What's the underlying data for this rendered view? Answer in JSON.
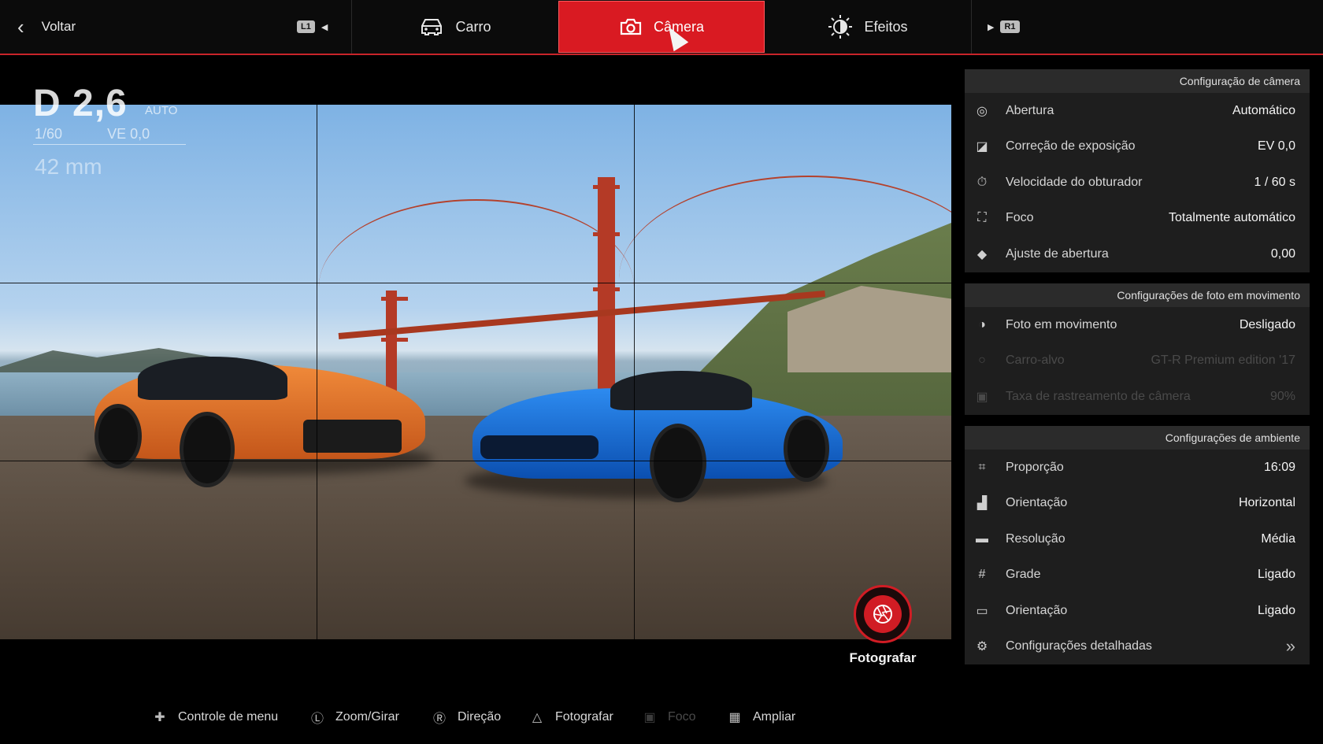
{
  "topbar": {
    "back_label": "Voltar",
    "l1_badge": "L1",
    "r1_badge": "R1",
    "tabs": [
      {
        "label": "Carro",
        "icon": "car-icon",
        "active": false
      },
      {
        "label": "Câmera",
        "icon": "camera-icon",
        "active": true
      },
      {
        "label": "Efeitos",
        "icon": "brightness-icon",
        "active": false
      }
    ],
    "accent_color": "#d91a22"
  },
  "viewfinder": {
    "mode": "D",
    "aperture": "2,6",
    "aperture_mode": "AUTO",
    "shutter": "1/60",
    "exposure": "VE 0,0",
    "focal_length": "42 mm"
  },
  "shutter_button": {
    "label": "Fotografar"
  },
  "camera_settings": {
    "header": "Configuração de câmera",
    "rows": [
      {
        "label": "Abertura",
        "value": "Automático",
        "icon": "aperture-icon",
        "disabled": false
      },
      {
        "label": "Correção de exposição",
        "value": "EV 0,0",
        "icon": "exposure-icon",
        "disabled": false
      },
      {
        "label": "Velocidade do obturador",
        "value": "1 / 60 s",
        "icon": "timer-icon",
        "disabled": false
      },
      {
        "label": "Foco",
        "value": "Totalmente automático",
        "icon": "focus-icon",
        "disabled": false
      },
      {
        "label": "Ajuste de abertura",
        "value": "0,00",
        "icon": "aperture-adjust-icon",
        "disabled": false
      }
    ]
  },
  "motion_settings": {
    "header": "Configurações de foto em movimento",
    "rows": [
      {
        "label": "Foto em movimento",
        "value": "Desligado",
        "icon": "toggle-icon",
        "disabled": false
      },
      {
        "label": "Carro-alvo",
        "value": "GT-R Premium edition '17",
        "icon": "target-icon",
        "disabled": true
      },
      {
        "label": "Taxa de rastreamento de câmera",
        "value": "90%",
        "icon": "tracking-icon",
        "disabled": true
      }
    ]
  },
  "environment_settings": {
    "header": "Configurações de ambiente",
    "rows": [
      {
        "label": "Proporção",
        "value": "16:09",
        "icon": "crop-icon",
        "disabled": false
      },
      {
        "label": "Orientação",
        "value": "Horizontal",
        "icon": "orientation-icon",
        "disabled": false
      },
      {
        "label": "Resolução",
        "value": "Média",
        "icon": "resolution-icon",
        "disabled": false
      },
      {
        "label": "Grade",
        "value": "Ligado",
        "icon": "grid-icon",
        "disabled": false
      },
      {
        "label": "Orientação",
        "value": "Ligado",
        "icon": "speech-bubble-icon",
        "disabled": false
      },
      {
        "label": "Configurações detalhadas",
        "value": "»",
        "icon": "gear-icon",
        "disabled": false
      }
    ]
  },
  "help_bar": [
    {
      "label": "Controle de menu",
      "icon": "dpad-icon",
      "disabled": false
    },
    {
      "label": "Zoom/Girar",
      "icon": "left-stick-icon",
      "disabled": false
    },
    {
      "label": "Direção",
      "icon": "right-stick-icon",
      "disabled": false
    },
    {
      "label": "Fotografar",
      "icon": "triangle-button-icon",
      "disabled": false
    },
    {
      "label": "Foco",
      "icon": "square-button-icon",
      "disabled": true
    },
    {
      "label": "Ampliar",
      "icon": "touchpad-icon",
      "disabled": false
    }
  ]
}
